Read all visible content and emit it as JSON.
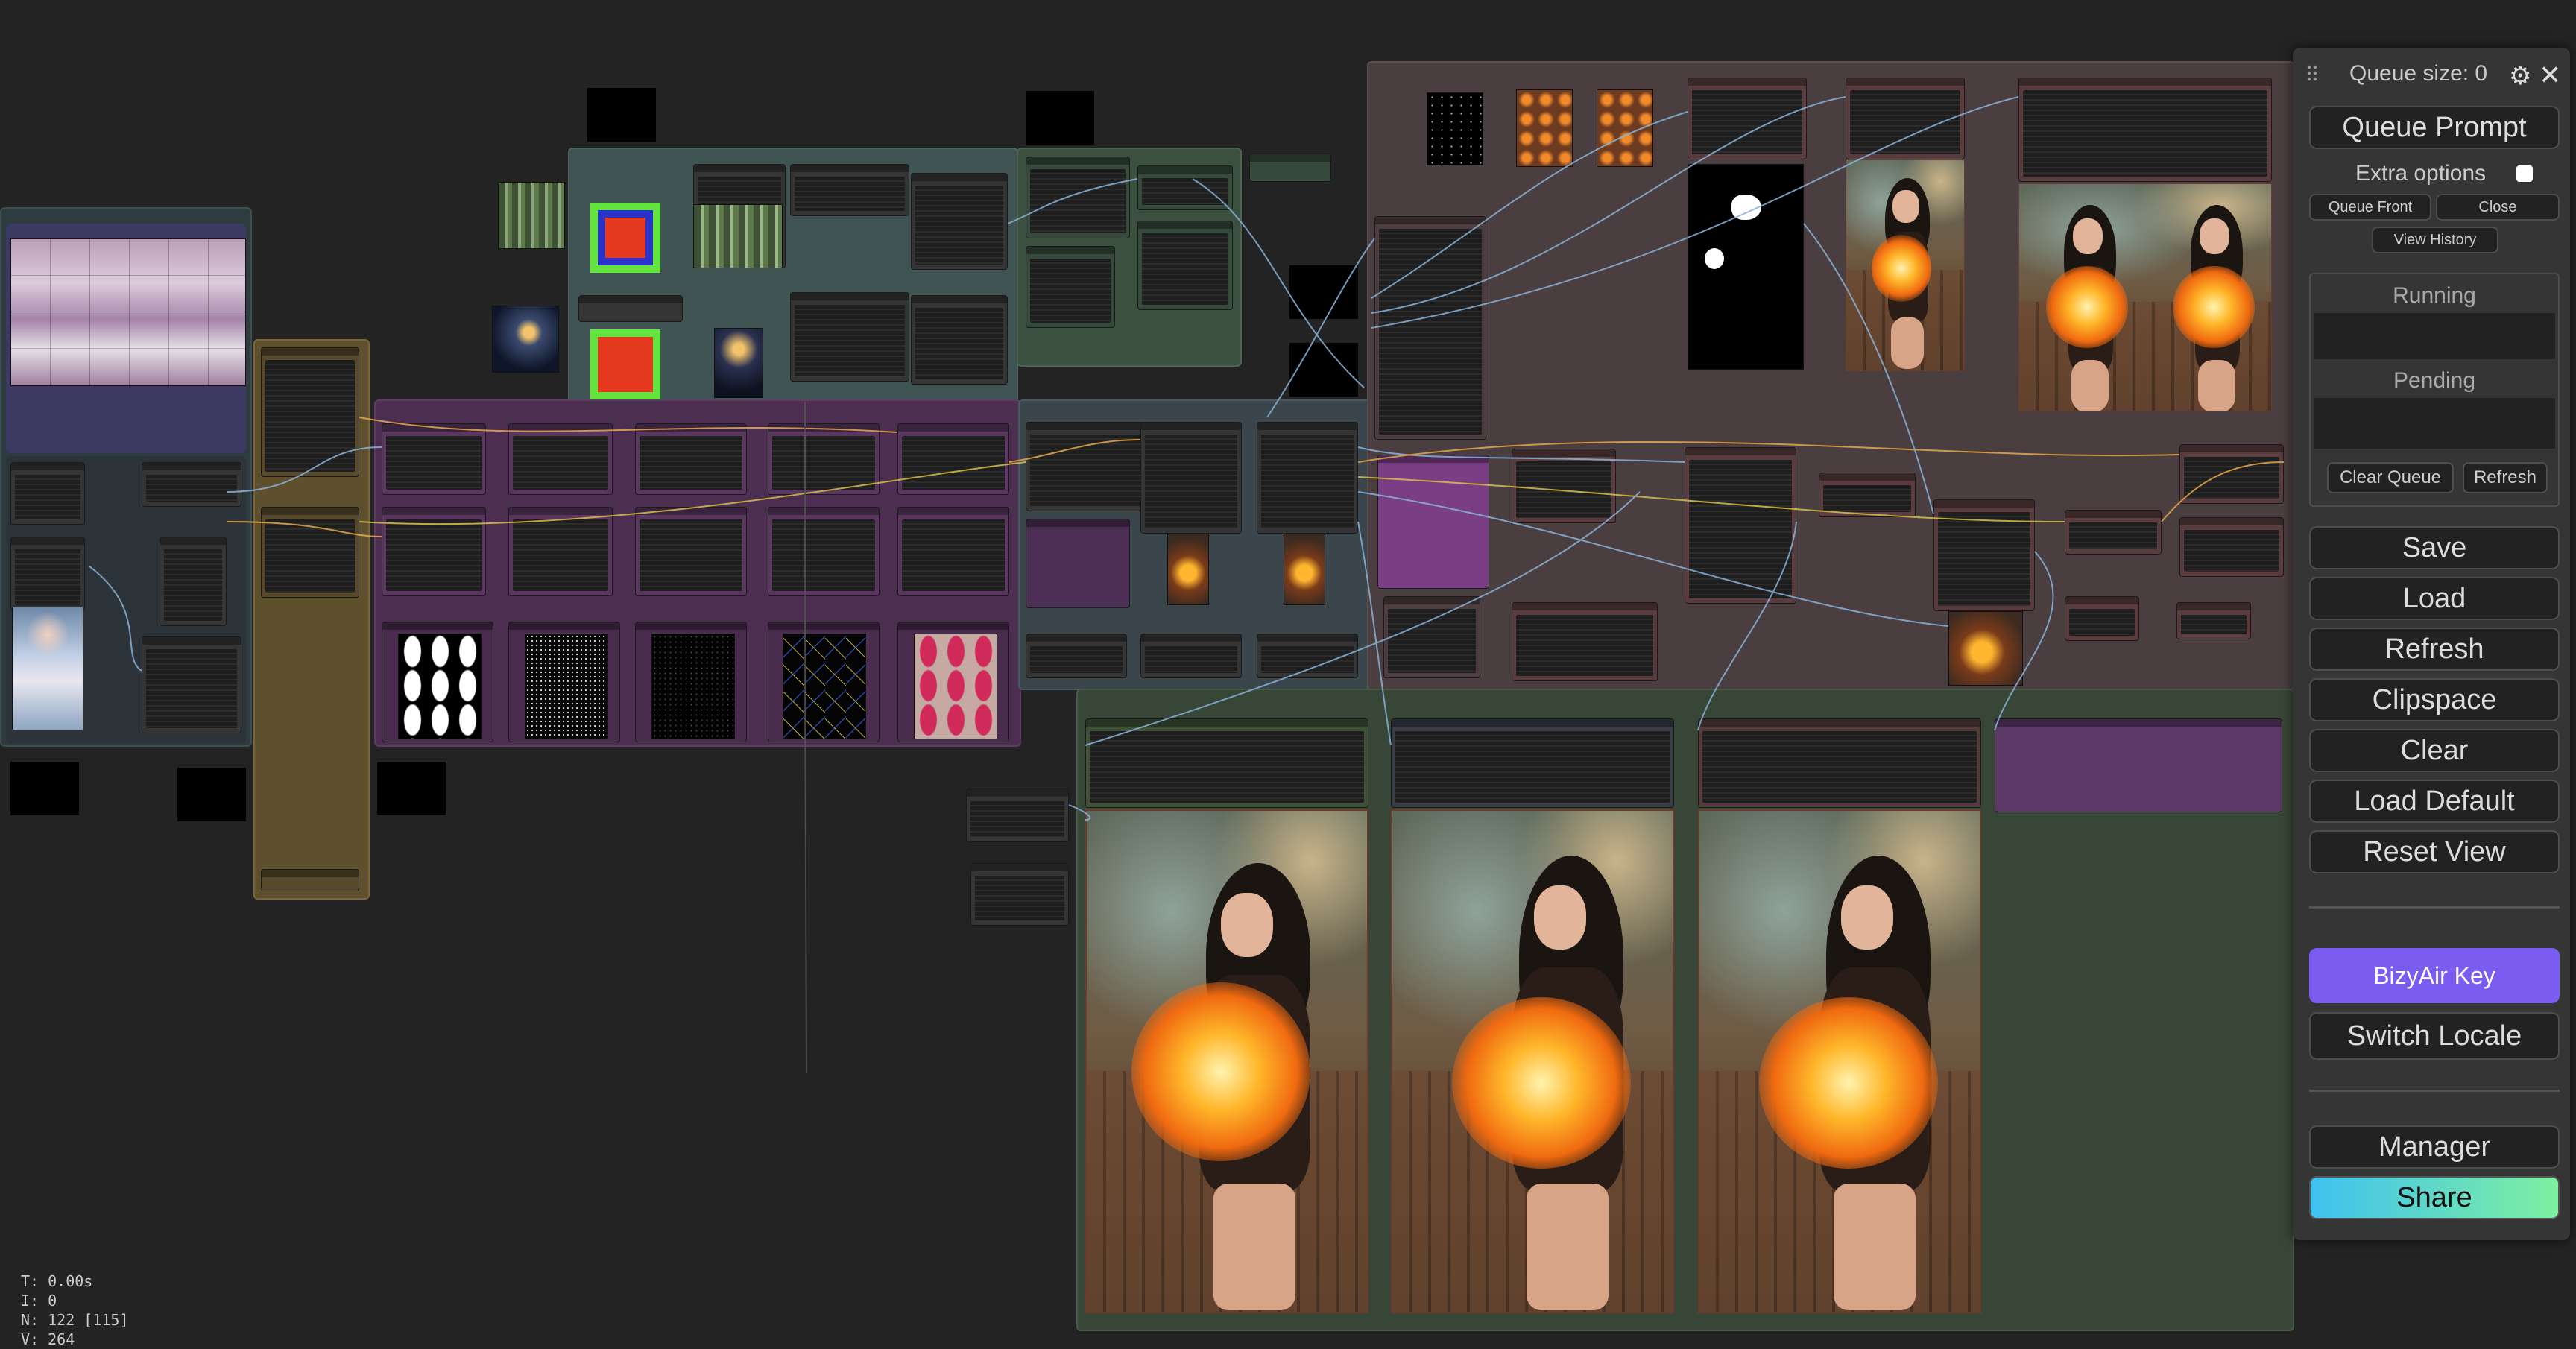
{
  "menu": {
    "queue_size": "Queue size: 0",
    "queue_prompt": "Queue Prompt",
    "extra_options": "Extra options",
    "queue_front": "Queue Front",
    "close": "Close",
    "view_history": "View History",
    "running": "Running",
    "pending": "Pending",
    "clear_queue": "Clear Queue",
    "refresh_small": "Refresh",
    "save": "Save",
    "load": "Load",
    "refresh": "Refresh",
    "clipspace": "Clipspace",
    "clear": "Clear",
    "load_default": "Load Default",
    "reset_view": "Reset View",
    "bizyair_key": "BizyAir Key",
    "switch_locale": "Switch Locale",
    "manager": "Manager",
    "share": "Share"
  },
  "stats": {
    "t": "T: 0.00s",
    "i": "I: 0",
    "n": "N: 122 [115]",
    "v": "V: 264"
  },
  "colors": {
    "canvas": "#232323",
    "bizyair": "#7b5cf0",
    "share_from": "#3fc1f0",
    "share_to": "#7ef0a0"
  }
}
